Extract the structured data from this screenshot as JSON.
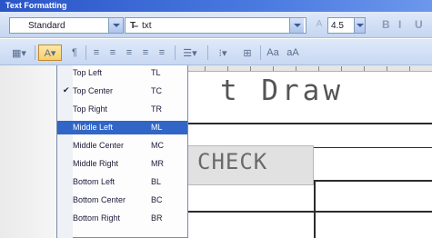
{
  "window": {
    "title": "Text Formatting"
  },
  "toolbar": {
    "style": "Standard",
    "font_icon": "T̶",
    "font": "txt",
    "size": "4.5",
    "accent_color": "#3166c7"
  },
  "justify_menu": {
    "items": [
      {
        "label": "Top Left",
        "key": "TL",
        "checked": false
      },
      {
        "label": "Top Center",
        "key": "TC",
        "checked": true
      },
      {
        "label": "Top Right",
        "key": "TR",
        "checked": false
      },
      {
        "label": "Middle Left",
        "key": "ML",
        "checked": false,
        "highlighted": true
      },
      {
        "label": "Middle Center",
        "key": "MC",
        "checked": false
      },
      {
        "label": "Middle Right",
        "key": "MR",
        "checked": false
      },
      {
        "label": "Bottom Left",
        "key": "BL",
        "checked": false
      },
      {
        "label": "Bottom Center",
        "key": "BC",
        "checked": false
      },
      {
        "label": "Bottom Right",
        "key": "BR",
        "checked": false
      }
    ]
  },
  "canvas": {
    "title_text": "t Draw",
    "cell_text": "CHECK"
  }
}
